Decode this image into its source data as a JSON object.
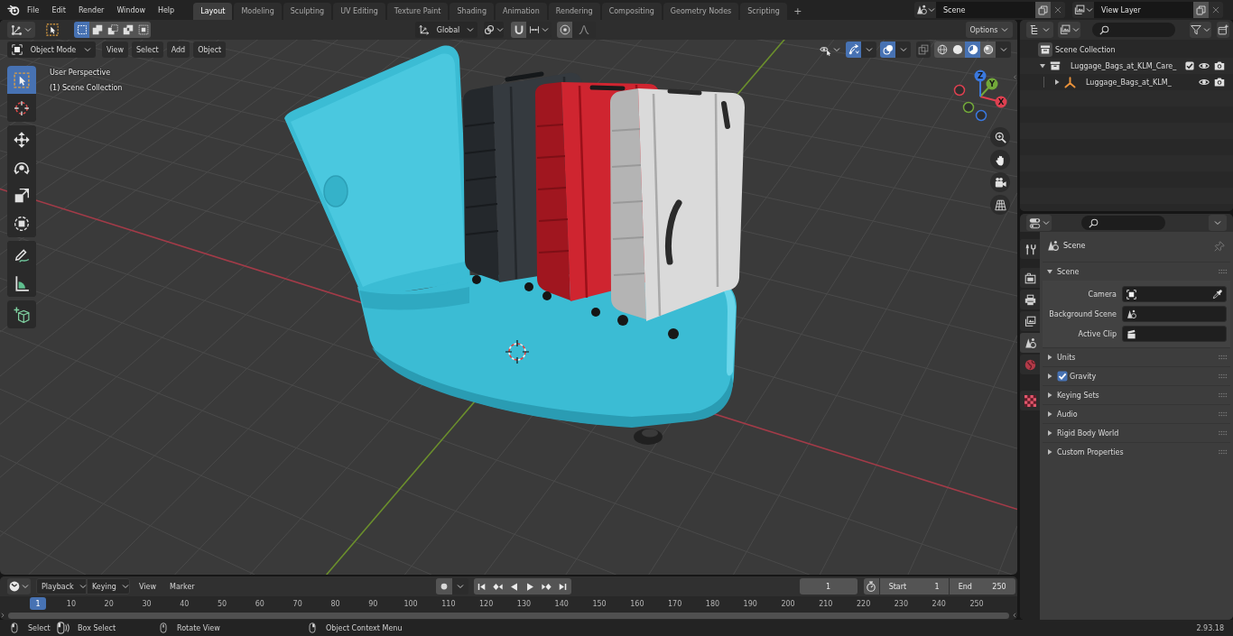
{
  "top_bar": {
    "menus": [
      "File",
      "Edit",
      "Render",
      "Window",
      "Help"
    ],
    "workspaces": [
      {
        "label": "Layout",
        "selected": true
      },
      {
        "label": "Modeling",
        "selected": false
      },
      {
        "label": "Sculpting",
        "selected": false
      },
      {
        "label": "UV Editing",
        "selected": false
      },
      {
        "label": "Texture Paint",
        "selected": false
      },
      {
        "label": "Shading",
        "selected": false
      },
      {
        "label": "Animation",
        "selected": false
      },
      {
        "label": "Rendering",
        "selected": false
      },
      {
        "label": "Compositing",
        "selected": false
      },
      {
        "label": "Geometry Nodes",
        "selected": false
      },
      {
        "label": "Scripting",
        "selected": false
      }
    ],
    "add_workspace": "+",
    "scene": "Scene",
    "view_layer": "View Layer"
  },
  "viewport": {
    "select_modes": [
      {
        "kind": "set",
        "selected": true
      },
      {
        "kind": "extend",
        "selected": false
      },
      {
        "kind": "subtract",
        "selected": false
      },
      {
        "kind": "difference",
        "selected": false
      },
      {
        "kind": "intersect",
        "selected": false
      }
    ],
    "orientation": "Global",
    "options": "Options",
    "mode": "Object Mode",
    "menus": [
      "View",
      "Select",
      "Add",
      "Object"
    ],
    "toggles": [
      {
        "kind": "gizmos",
        "on": true
      },
      {
        "kind": "overlays",
        "on": true
      },
      {
        "kind": "xray",
        "on": false
      }
    ],
    "shading": [
      {
        "kind": "wireframe",
        "selected": false
      },
      {
        "kind": "solid",
        "selected": false
      },
      {
        "kind": "material",
        "selected": true
      },
      {
        "kind": "rendered",
        "selected": false
      }
    ],
    "tool_groups": [
      [
        {
          "kind": "select-box",
          "selected": true
        },
        {
          "kind": "cursor",
          "selected": false
        }
      ],
      [
        {
          "kind": "move",
          "selected": false
        },
        {
          "kind": "rotate",
          "selected": false
        },
        {
          "kind": "scale",
          "selected": false
        },
        {
          "kind": "transform",
          "selected": false
        }
      ],
      [
        {
          "kind": "annotate",
          "selected": false
        },
        {
          "kind": "measure",
          "selected": false
        }
      ],
      [
        {
          "kind": "add-cube",
          "selected": false
        }
      ]
    ],
    "info": [
      "User Perspective",
      "(1) Scene Collection"
    ],
    "gizmo_axes": [
      {
        "label": "X",
        "color": "#de4050"
      },
      {
        "label": "Y",
        "color": "#72a83a"
      },
      {
        "label": "Z",
        "color": "#3a78de"
      }
    ]
  },
  "timeline": {
    "menus": [
      {
        "label": "Playback",
        "kind": "dropdown"
      },
      {
        "label": "Keying",
        "kind": "dropdown"
      },
      {
        "label": "View",
        "kind": "menu"
      },
      {
        "label": "Marker",
        "kind": "menu"
      }
    ],
    "current_frame": "1",
    "start": {
      "label": "Start",
      "value": "1"
    },
    "end": {
      "label": "End",
      "value": "250"
    },
    "playhead": "1",
    "ticks": [
      "10",
      "20",
      "30",
      "40",
      "50",
      "60",
      "70",
      "80",
      "90",
      "100",
      "110",
      "120",
      "130",
      "140",
      "150",
      "160",
      "170",
      "180",
      "190",
      "200",
      "210",
      "220",
      "230",
      "240",
      "250"
    ]
  },
  "outliner": {
    "items": [
      {
        "label": "Scene Collection",
        "kind": "scene-collection",
        "children": [
          {
            "label": "Luggage_Bags_at_KLM_Care_",
            "kind": "collection",
            "expanded": true,
            "checked": true,
            "children": [
              {
                "label": "Luggage_Bags_at_KLM_",
                "kind": "object",
                "expanded": false
              }
            ]
          }
        ]
      }
    ]
  },
  "properties": {
    "tab_groups": [
      [
        {
          "kind": "tool",
          "selected": false
        }
      ],
      [
        {
          "kind": "render",
          "selected": false
        },
        {
          "kind": "output",
          "selected": false
        },
        {
          "kind": "view-layer",
          "selected": false
        },
        {
          "kind": "scene",
          "selected": true
        },
        {
          "kind": "world",
          "selected": false
        }
      ],
      [
        {
          "kind": "texture",
          "selected": false
        }
      ]
    ],
    "context": "Scene",
    "panels": [
      {
        "title": "Scene",
        "expanded": true,
        "fields": [
          {
            "label": "Camera",
            "kind": "camera"
          },
          {
            "label": "Background Scene",
            "kind": "scene"
          },
          {
            "label": "Active Clip",
            "kind": "clip"
          }
        ]
      },
      {
        "title": "Units",
        "expanded": false
      },
      {
        "title": "Gravity",
        "expanded": false,
        "checked": true
      },
      {
        "title": "Keying Sets",
        "expanded": false
      },
      {
        "title": "Audio",
        "expanded": false
      },
      {
        "title": "Rigid Body World",
        "expanded": false
      },
      {
        "title": "Custom Properties",
        "expanded": false
      }
    ]
  },
  "status_bar": {
    "hints": [
      {
        "kind": "left",
        "label": "Select"
      },
      {
        "kind": "left-drag",
        "label": "Box Select"
      },
      {
        "kind": "middle",
        "label": "Rotate View"
      },
      {
        "kind": "right",
        "label": "Object Context Menu"
      }
    ],
    "version": "2.93.18"
  }
}
